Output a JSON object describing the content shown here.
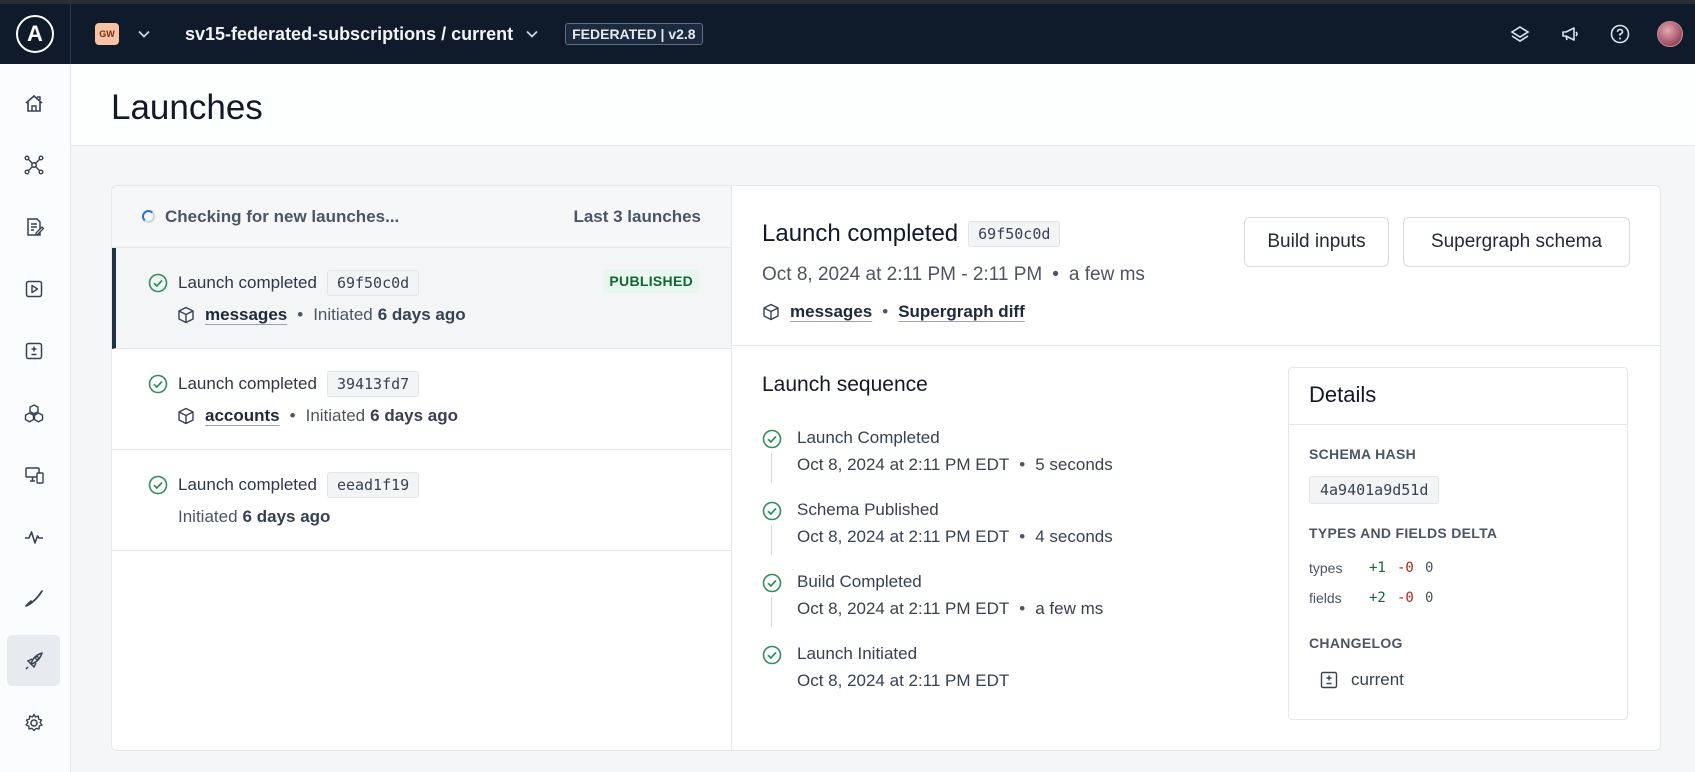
{
  "topbar": {
    "logo_letter": "A",
    "org_badge": "GW",
    "graph_title": "sv15-federated-subscriptions / current",
    "federation_badge": "FEDERATED | v2.8"
  },
  "page": {
    "title": "Launches"
  },
  "launch_list": {
    "status": "Checking for new launches...",
    "count_label": "Last 3 launches",
    "items": [
      {
        "label": "Launch completed",
        "hash": "69f50c0d",
        "badge": "PUBLISHED",
        "subgraph": "messages",
        "initiated_prefix": "Initiated",
        "initiated": "6 days ago"
      },
      {
        "label": "Launch completed",
        "hash": "39413fd7",
        "subgraph": "accounts",
        "initiated_prefix": "Initiated",
        "initiated": "6 days ago"
      },
      {
        "label": "Launch completed",
        "hash": "eead1f19",
        "initiated_prefix": "Initiated",
        "initiated": "6 days ago"
      }
    ]
  },
  "detail": {
    "title": "Launch completed",
    "hash": "69f50c0d",
    "date_range": "Oct 8, 2024 at 2:11 PM - 2:11 PM",
    "duration": "a few ms",
    "subgraph_link": "messages",
    "diff_link": "Supergraph diff",
    "build_inputs_label": "Build inputs",
    "supergraph_schema_label": "Supergraph schema",
    "sequence_title": "Launch sequence",
    "sequence": [
      {
        "name": "Launch Completed",
        "time": "Oct 8, 2024 at 2:11 PM EDT",
        "duration": "5 seconds"
      },
      {
        "name": "Schema Published",
        "time": "Oct 8, 2024 at 2:11 PM EDT",
        "duration": "4 seconds"
      },
      {
        "name": "Build Completed",
        "time": "Oct 8, 2024 at 2:11 PM EDT",
        "duration": "a few ms"
      },
      {
        "name": "Launch Initiated",
        "time": "Oct 8, 2024 at 2:11 PM EDT"
      }
    ],
    "details": {
      "title": "Details",
      "schema_hash_label": "SCHEMA HASH",
      "schema_hash": "4a9401a9d51d",
      "delta_label": "TYPES AND FIELDS DELTA",
      "types": {
        "label": "types",
        "added": "+1",
        "removed": "-0",
        "changed": "0"
      },
      "fields": {
        "label": "fields",
        "added": "+2",
        "removed": "-0",
        "changed": "0"
      },
      "changelog_label": "CHANGELOG",
      "changelog_entry": "current"
    }
  },
  "colors": {
    "topbar_bg": "#0f1b2b",
    "success_green": "#2f8f5b",
    "published_bg": "#e8f7ee",
    "published_text": "#166534"
  },
  "icons": {
    "sidebar": [
      "home-icon",
      "graph-icon",
      "schema-icon",
      "explorer-icon",
      "checks-icon",
      "subgraphs-icon",
      "clients-icon",
      "insights-icon",
      "check-icon",
      "launches-icon",
      "settings-icon"
    ],
    "topbar": [
      "layers-icon",
      "announcement-icon",
      "help-icon",
      "avatar"
    ]
  }
}
